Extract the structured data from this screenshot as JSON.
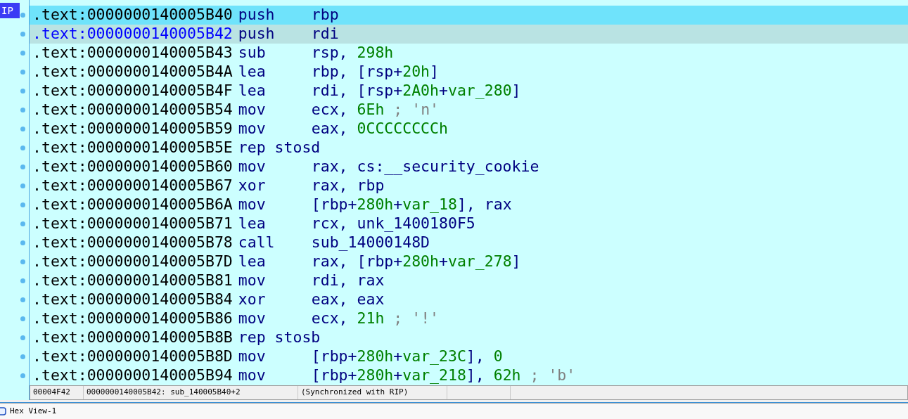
{
  "ip_label": "IP",
  "rows": [
    {
      "address": ".text:0000000140005B40",
      "mnemonic": "push",
      "operands": [
        {
          "text": "rbp",
          "kind": "reg"
        }
      ],
      "selected": true,
      "current": false
    },
    {
      "address": ".text:0000000140005B42",
      "mnemonic": "push",
      "operands": [
        {
          "text": "rdi",
          "kind": "reg"
        }
      ],
      "selected": false,
      "current": true
    },
    {
      "address": ".text:0000000140005B43",
      "mnemonic": "sub",
      "operands": [
        {
          "text": "rsp, ",
          "kind": "reg"
        },
        {
          "text": "298h",
          "kind": "num"
        }
      ],
      "selected": false,
      "current": false
    },
    {
      "address": ".text:0000000140005B4A",
      "mnemonic": "lea",
      "operands": [
        {
          "text": "rbp, [rsp+",
          "kind": "reg"
        },
        {
          "text": "20h",
          "kind": "num"
        },
        {
          "text": "]",
          "kind": "reg"
        }
      ],
      "selected": false,
      "current": false
    },
    {
      "address": ".text:0000000140005B4F",
      "mnemonic": "lea",
      "operands": [
        {
          "text": "rdi, [rsp+",
          "kind": "reg"
        },
        {
          "text": "2A0h",
          "kind": "num"
        },
        {
          "text": "+",
          "kind": "reg"
        },
        {
          "text": "var_280",
          "kind": "num"
        },
        {
          "text": "]",
          "kind": "reg"
        }
      ],
      "selected": false,
      "current": false
    },
    {
      "address": ".text:0000000140005B54",
      "mnemonic": "mov",
      "operands": [
        {
          "text": "ecx, ",
          "kind": "reg"
        },
        {
          "text": "6Eh",
          "kind": "num"
        },
        {
          "text": " ; 'n'",
          "kind": "comment"
        }
      ],
      "selected": false,
      "current": false
    },
    {
      "address": ".text:0000000140005B59",
      "mnemonic": "mov",
      "operands": [
        {
          "text": "eax, ",
          "kind": "reg"
        },
        {
          "text": "0CCCCCCCCh",
          "kind": "num"
        }
      ],
      "selected": false,
      "current": false
    },
    {
      "address": ".text:0000000140005B5E",
      "mnemonic": "rep stosd",
      "operands": [],
      "selected": false,
      "current": false
    },
    {
      "address": ".text:0000000140005B60",
      "mnemonic": "mov",
      "operands": [
        {
          "text": "rax, cs:__security_cookie",
          "kind": "reg"
        }
      ],
      "selected": false,
      "current": false
    },
    {
      "address": ".text:0000000140005B67",
      "mnemonic": "xor",
      "operands": [
        {
          "text": "rax, rbp",
          "kind": "reg"
        }
      ],
      "selected": false,
      "current": false
    },
    {
      "address": ".text:0000000140005B6A",
      "mnemonic": "mov",
      "operands": [
        {
          "text": "[rbp+",
          "kind": "reg"
        },
        {
          "text": "280h",
          "kind": "num"
        },
        {
          "text": "+",
          "kind": "reg"
        },
        {
          "text": "var_18",
          "kind": "num"
        },
        {
          "text": "], rax",
          "kind": "reg"
        }
      ],
      "selected": false,
      "current": false
    },
    {
      "address": ".text:0000000140005B71",
      "mnemonic": "lea",
      "operands": [
        {
          "text": "rcx, unk_1400180F5",
          "kind": "reg"
        }
      ],
      "selected": false,
      "current": false
    },
    {
      "address": ".text:0000000140005B78",
      "mnemonic": "call",
      "operands": [
        {
          "text": "sub_14000148D",
          "kind": "reg"
        }
      ],
      "selected": false,
      "current": false
    },
    {
      "address": ".text:0000000140005B7D",
      "mnemonic": "lea",
      "operands": [
        {
          "text": "rax, [rbp+",
          "kind": "reg"
        },
        {
          "text": "280h",
          "kind": "num"
        },
        {
          "text": "+",
          "kind": "reg"
        },
        {
          "text": "var_278",
          "kind": "num"
        },
        {
          "text": "]",
          "kind": "reg"
        }
      ],
      "selected": false,
      "current": false
    },
    {
      "address": ".text:0000000140005B81",
      "mnemonic": "mov",
      "operands": [
        {
          "text": "rdi, rax",
          "kind": "reg"
        }
      ],
      "selected": false,
      "current": false
    },
    {
      "address": ".text:0000000140005B84",
      "mnemonic": "xor",
      "operands": [
        {
          "text": "eax, eax",
          "kind": "reg"
        }
      ],
      "selected": false,
      "current": false
    },
    {
      "address": ".text:0000000140005B86",
      "mnemonic": "mov",
      "operands": [
        {
          "text": "ecx, ",
          "kind": "reg"
        },
        {
          "text": "21h",
          "kind": "num"
        },
        {
          "text": " ; '!'",
          "kind": "comment"
        }
      ],
      "selected": false,
      "current": false
    },
    {
      "address": ".text:0000000140005B8B",
      "mnemonic": "rep stosb",
      "operands": [],
      "selected": false,
      "current": false
    },
    {
      "address": ".text:0000000140005B8D",
      "mnemonic": "mov",
      "operands": [
        {
          "text": "[rbp+",
          "kind": "reg"
        },
        {
          "text": "280h",
          "kind": "num"
        },
        {
          "text": "+",
          "kind": "reg"
        },
        {
          "text": "var_23C",
          "kind": "num"
        },
        {
          "text": "], ",
          "kind": "reg"
        },
        {
          "text": "0",
          "kind": "num"
        }
      ],
      "selected": false,
      "current": false
    },
    {
      "address": ".text:0000000140005B94",
      "mnemonic": "mov",
      "operands": [
        {
          "text": "[rbp+",
          "kind": "reg"
        },
        {
          "text": "280h",
          "kind": "num"
        },
        {
          "text": "+",
          "kind": "reg"
        },
        {
          "text": "var_218",
          "kind": "num"
        },
        {
          "text": "], ",
          "kind": "reg"
        },
        {
          "text": "62h",
          "kind": "num"
        },
        {
          "text": " ; 'b'",
          "kind": "comment"
        }
      ],
      "selected": false,
      "current": false
    }
  ],
  "status_bar": [
    "00004F42",
    "0000000140005B42: sub_140005B40+2",
    "(Synchronized with RIP)"
  ],
  "bottom_tab": {
    "label": "Hex View-1"
  }
}
